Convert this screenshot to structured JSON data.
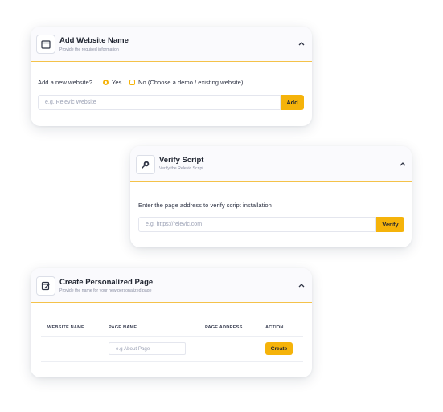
{
  "card1": {
    "title": "Add Website Name",
    "subtitle": "Provide the required information",
    "question": "Add a new website?",
    "options": [
      "Yes",
      "No (Choose a demo / existing website)"
    ],
    "selected": "Yes",
    "input_placeholder": "e.g. Relevic Website",
    "button": "Add",
    "icon": "browser-window-icon"
  },
  "card2": {
    "title": "Verify Script",
    "subtitle": "Verify the Relevic Script",
    "instruction": "Enter the page address to verify script installation",
    "input_placeholder": "e.g. https://relevic.com",
    "button": "Verify",
    "icon": "magnifier-icon"
  },
  "card3": {
    "title": "Create Personalized Page",
    "subtitle": "Provide the name for your new personalized page",
    "columns": [
      "WEBSITE NAME",
      "PAGE NAME",
      "PAGE ADDRESS",
      "ACTION"
    ],
    "input_placeholder": "e.g About Page",
    "button": "Create",
    "icon": "page-edit-icon"
  },
  "colors": {
    "accent": "#f5b30a",
    "divider": "#f4c24a"
  }
}
